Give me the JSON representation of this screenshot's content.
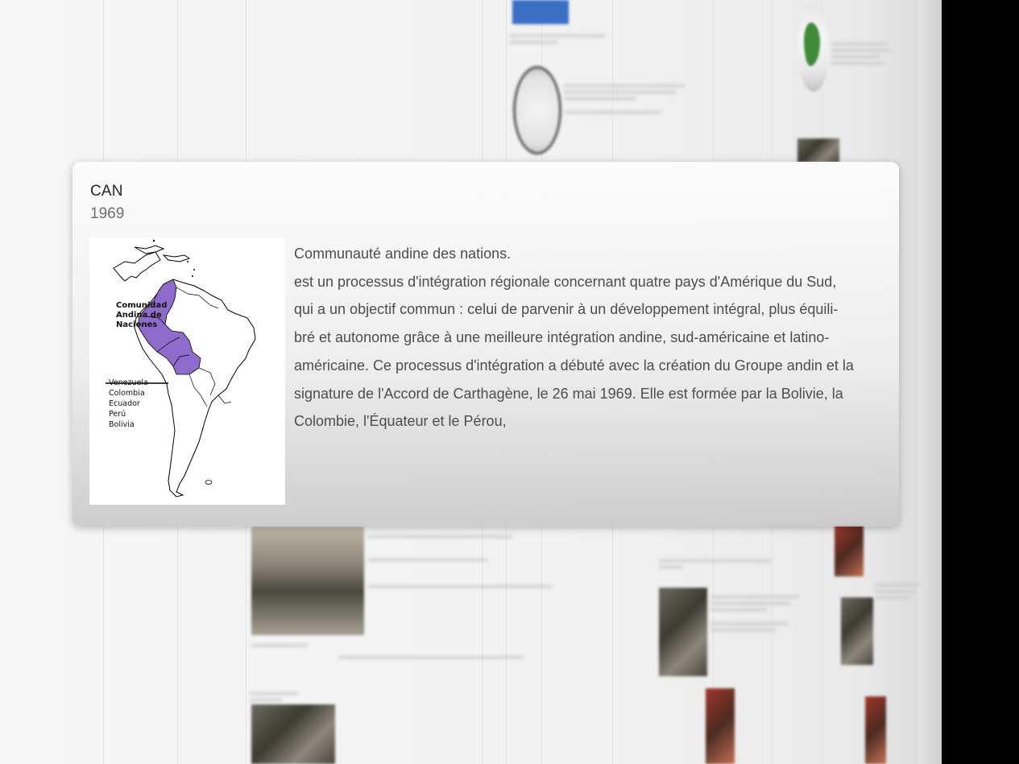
{
  "popup": {
    "title": "CAN",
    "year": "1969",
    "image": {
      "icon": "map-andean-community",
      "map_title": [
        "Comunidad",
        "Andina de",
        "Naciones"
      ],
      "countries": [
        "Venezuela",
        "Colombia",
        "Ecuador",
        "Perú",
        "Bolivia"
      ],
      "highlight_color": "#8e6ccb"
    },
    "text": {
      "line1": "Communauté andine des nations.",
      "line2": "est un processus d'intégration régionale concernant quatre pays d'Amérique du Sud,",
      "line3": "qui a un objectif commun : celui de parvenir à un développement intégral, plus équili-",
      "line4": "bré et autonome grâce à une meilleure intégration andine, sud-américaine et latino-",
      "line5": "américaine. Ce processus d'intégration a débuté avec la création du Groupe andin et la",
      "line6": "signature de l'Accord de Carthagène, le 26 mai 1969. Elle est formée par la Bolivie, la",
      "line7": "Colombie, l'Équateur et le Pérou,"
    }
  },
  "colors": {
    "black_edge": "#000000",
    "card_text": "#4d4d4d"
  }
}
